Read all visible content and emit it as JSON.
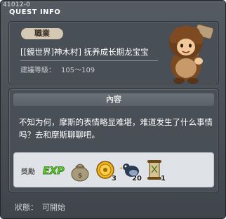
{
  "window": {
    "quest_id": "41012-0",
    "title": "QUEST INFO"
  },
  "header": {
    "job_tag": "職業",
    "quest_name": "[[鏡世界]神木村] 抚养成长期龙宝宝",
    "level_label": "建議等級：",
    "level_value": "105～109"
  },
  "content": {
    "header": "內容",
    "description": "不知为何，摩斯的表情略显难堪，难道发生了什么事情吗？去和摩斯聊聊吧。"
  },
  "rewards": {
    "label": "獎勵",
    "items": [
      {
        "icon": "exp-icon",
        "text": "EXP",
        "count": ""
      },
      {
        "icon": "money-bag-icon",
        "count": ""
      },
      {
        "icon": "gold-coin-icon",
        "count": "3"
      },
      {
        "icon": "bird-item-icon",
        "count": "20"
      },
      {
        "icon": "scroll-item-icon",
        "count": "1"
      }
    ]
  },
  "status": {
    "label": "狀態：",
    "value": "可開始"
  },
  "colors": {
    "window_bg": "#4b5158",
    "panel_bg": "#494f57",
    "job_tag_bg": "#d6c9b4",
    "reward_bg": "#dfe2e6",
    "exp_green": "#5bd12a"
  }
}
